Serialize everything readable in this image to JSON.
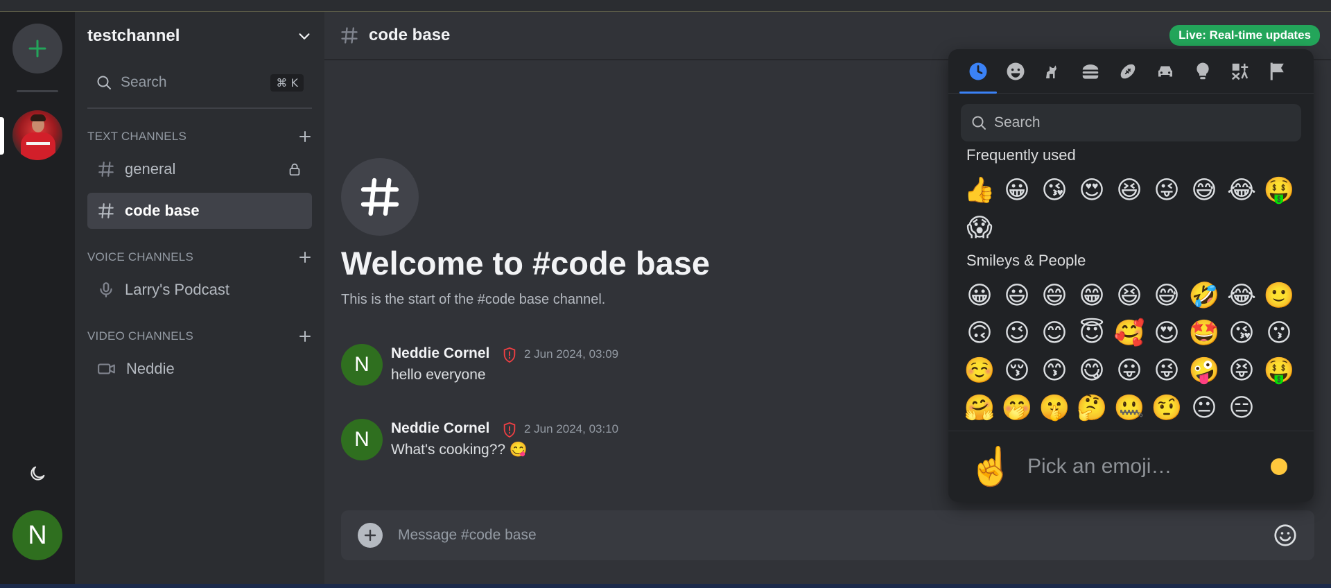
{
  "colors": {
    "accent": "#23a55a",
    "tab_active": "#3b82f6",
    "avatar_green": "#2f6f1f",
    "shield_red": "#f23f43"
  },
  "rail": {
    "add_icon": "plus-icon",
    "theme_icon": "moon-icon",
    "user_initial": "N"
  },
  "sidebar": {
    "guild_name": "testchannel",
    "search_placeholder": "Search",
    "search_shortcut": "⌘ K",
    "categories": [
      {
        "label": "TEXT CHANNELS"
      },
      {
        "label": "VOICE CHANNELS"
      },
      {
        "label": "VIDEO CHANNELS"
      }
    ],
    "channels": [
      {
        "name": "general",
        "type": "text",
        "locked": true
      },
      {
        "name": "code base",
        "type": "text",
        "active": true
      },
      {
        "name": "Larry's Podcast",
        "type": "voice"
      },
      {
        "name": "Neddie",
        "type": "video"
      }
    ]
  },
  "header": {
    "channel_name": "code base",
    "live_badge": "Live: Real-time updates"
  },
  "welcome": {
    "title": "Welcome to #code base",
    "subtitle": "This is the start of the #code base channel."
  },
  "messages": [
    {
      "initial": "N",
      "author": "Neddie Cornel",
      "time": "2 Jun 2024, 03:09",
      "text": "hello everyone"
    },
    {
      "initial": "N",
      "author": "Neddie Cornel",
      "time": "2 Jun 2024, 03:10",
      "text": "What's cooking?? 😋"
    }
  ],
  "composer": {
    "placeholder": "Message #code base"
  },
  "emoji_picker": {
    "categories": [
      {
        "icon": "clock-icon",
        "label": "Recent",
        "active": true
      },
      {
        "icon": "smiley-icon",
        "label": "Smileys"
      },
      {
        "icon": "dog-icon",
        "label": "Animals"
      },
      {
        "icon": "burger-icon",
        "label": "Food"
      },
      {
        "icon": "football-icon",
        "label": "Activities"
      },
      {
        "icon": "car-icon",
        "label": "Travel"
      },
      {
        "icon": "bulb-icon",
        "label": "Objects"
      },
      {
        "icon": "symbols-icon",
        "label": "Symbols"
      },
      {
        "icon": "flag-icon",
        "label": "Flags"
      }
    ],
    "search_placeholder": "Search",
    "frequently_used_title": "Frequently used",
    "frequently_used": [
      "👍",
      "😀",
      "😘",
      "😍",
      "😆",
      "😜",
      "😅",
      "😂",
      "🤑",
      "😱"
    ],
    "smileys_title": "Smileys & People",
    "smileys": [
      "😀",
      "😃",
      "😄",
      "😁",
      "😆",
      "😅",
      "🤣",
      "😂",
      "🙂",
      "🙃",
      "😉",
      "😊",
      "😇",
      "🥰",
      "😍",
      "🤩",
      "😘",
      "😗",
      "☺️",
      "😚",
      "😙",
      "😋",
      "😛",
      "😜",
      "🤪",
      "😝",
      "🤑",
      "🤗",
      "🤭",
      "🤫",
      "🤔",
      "🤐",
      "🤨",
      "😐",
      "😑"
    ],
    "footer_preview": "☝️",
    "footer_placeholder": "Pick an emoji…"
  }
}
